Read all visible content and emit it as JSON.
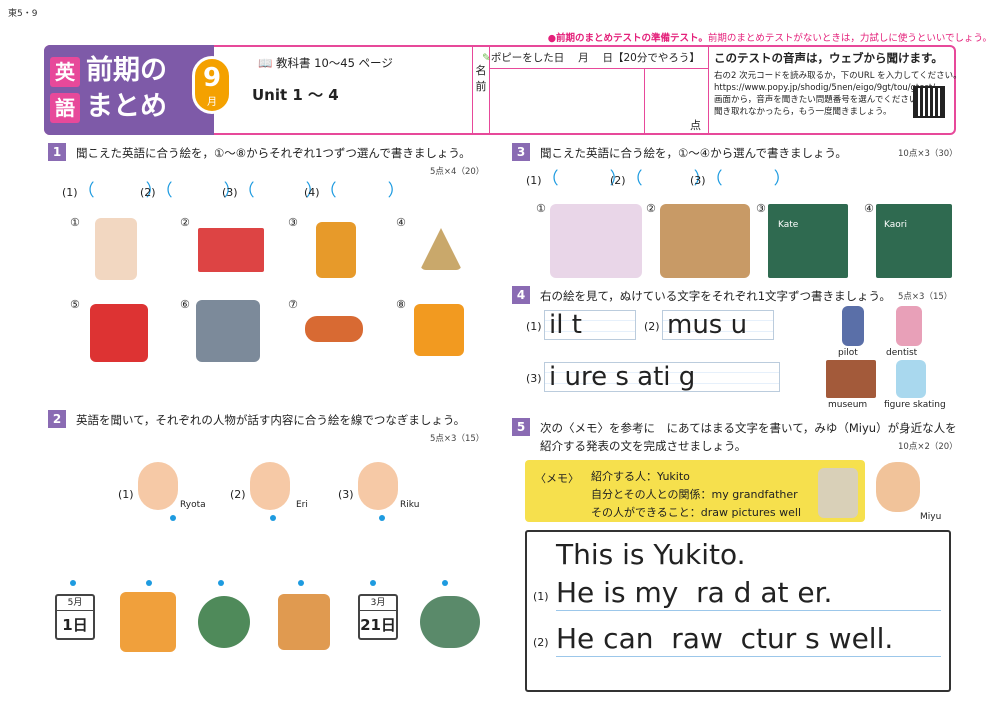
{
  "corner_code": "東5・9",
  "notice": {
    "bold": "●前期のまとめテストの準備テスト。",
    "rest": "前期のまとめテストがないときは，力試しに使うといいでしょう。"
  },
  "header": {
    "kanji1": "英",
    "kanji2": "語",
    "title1": "前期の",
    "title2": "まとめ",
    "month": "9",
    "month_unit": "月",
    "textbook": "教科書 10～45 ページ",
    "unit": "Unit 1 ～ 4",
    "name_label": "名前",
    "date_label": "ポピーをした日　 月　 日【20分でやろう】",
    "score_unit": "点",
    "audio_title": "このテストの音声は，ウェブから聞けます。",
    "audio_line1": "右の2 次元コードを読み取るか，下のURL を入力してください。",
    "audio_url": "https://www.popy.jp/shodig/5nen/eigo/9gt/tou/gtest/",
    "audio_line2": "画面から，音声を聞きたい問題番号を選んでください。",
    "audio_line3": "聞き取れなかったら，もう一度聞きましょう。"
  },
  "q1": {
    "num": "1",
    "text": "聞こえた英語に合う絵を，①～⑧からそれぞれ1つずつ選んで書きましょう。",
    "points": "5点×4（20）",
    "blanks": [
      "(1)",
      "(2)",
      "(3)",
      "(4)"
    ],
    "items": [
      "①",
      "②",
      "③",
      "④",
      "⑤",
      "⑥",
      "⑦",
      "⑧"
    ]
  },
  "q2": {
    "num": "2",
    "text": "英語を聞いて，それぞれの人物が話す内容に合う絵を線でつなぎましょう。",
    "points": "5点×3（15）",
    "people": [
      {
        "no": "(1)",
        "name": "Ryota"
      },
      {
        "no": "(2)",
        "name": "Eri"
      },
      {
        "no": "(3)",
        "name": "Riku"
      }
    ],
    "cal1": {
      "m": "5月",
      "d": "1日"
    },
    "cal2": {
      "m": "3月",
      "d": "21日"
    }
  },
  "q3": {
    "num": "3",
    "text": "聞こえた英語に合う絵を，①～④から選んで書きましょう。",
    "points": "10点×3（30）",
    "blanks": [
      "(1)",
      "(2)",
      "(3)"
    ],
    "items": [
      "①",
      "②",
      "③",
      "④"
    ],
    "names": [
      "Kate",
      "Kaori"
    ]
  },
  "q4": {
    "num": "4",
    "text": "右の絵を見て，ぬけている文字をそれぞれ1文字ずつ書きましょう。",
    "points": "5点×3（15）",
    "words": [
      {
        "no": "(1)",
        "text": "il t"
      },
      {
        "no": "(2)",
        "text": "mus u"
      },
      {
        "no": "(3)",
        "text": "i ure s ati g"
      }
    ],
    "labels": [
      "pilot",
      "dentist",
      "museum",
      "figure skating"
    ]
  },
  "q5": {
    "num": "5",
    "text1": "次の〈メモ〉を参考に　にあてはまる文字を書いて，みゆ（Miyu）が身近な人を",
    "text2": "紹介する発表の文を完成させましょう。",
    "points": "10点×2（20）",
    "memo_label": "〈メモ〉",
    "memo1": "紹介する人：Yukito",
    "memo2": "自分とその人との関係：my grandfather",
    "memo3": "その人ができること：draw pictures well",
    "miyu": "Miyu",
    "example": "This is Yukito.",
    "line1_no": "(1)",
    "line1": "He is my  ra d at er.",
    "line2_no": "(2)",
    "line2": "He can  raw  ctur s well."
  }
}
